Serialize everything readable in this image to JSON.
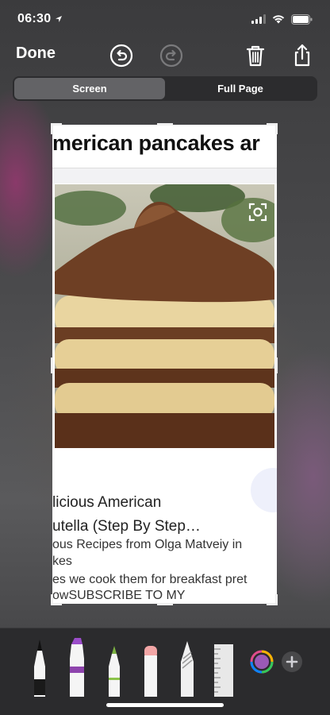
{
  "status_bar": {
    "time": "06:30"
  },
  "toolbar": {
    "done_label": "Done"
  },
  "segments": {
    "screen": "Screen",
    "full_page": "Full Page",
    "active": "screen"
  },
  "preview": {
    "title": "merican pancakes ar",
    "lines": [
      "licious American",
      "utella (Step By Step…",
      "ous Recipes from Olga Matveiy in",
      "kes",
      "es we cook them for breakfast pret",
      "owSUBSCRIBE TO MY"
    ]
  },
  "tools": [
    "pen-tool",
    "highlighter-tool",
    "pencil-tool",
    "eraser-tool",
    "lasso-tool",
    "ruler-tool",
    "color-picker",
    "add-tool"
  ],
  "colors": {
    "accent": "#ffffff",
    "toolbar_bg": "#2b2b2d",
    "highlighter": "#8e44ad",
    "pencil": "#8bc34a",
    "eraser": "#f2a6a6"
  }
}
